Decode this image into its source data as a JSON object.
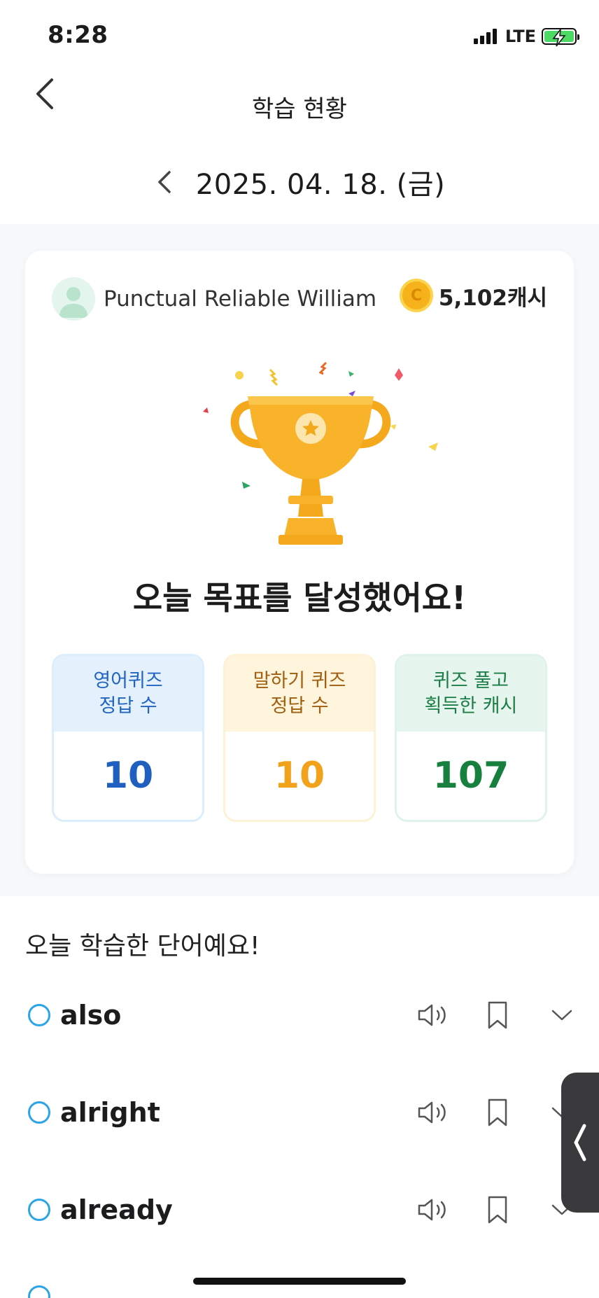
{
  "status_bar": {
    "time": "8:28",
    "network": "LTE"
  },
  "nav": {
    "title": "학습 현황"
  },
  "date": {
    "label": "2025. 04. 18. (금)"
  },
  "profile": {
    "name": "Punctual Reliable William",
    "cash": "5,102캐시",
    "coin_icon": "coin-icon"
  },
  "goal": {
    "message": "오늘 목표를 달성했어요!"
  },
  "stats": [
    {
      "line1": "영어퀴즈",
      "line2": "정답 수",
      "value": "10",
      "color": "#1f5fbf"
    },
    {
      "line1": "말하기 퀴즈",
      "line2": "정답 수",
      "value": "10",
      "color": "#f2a21a"
    },
    {
      "line1": "퀴즈 풀고",
      "line2": "획득한 캐시",
      "value": "107",
      "color": "#17803f"
    }
  ],
  "words_section": {
    "title": "오늘 학습한 단어예요!"
  },
  "words": [
    {
      "word": "also"
    },
    {
      "word": "alright"
    },
    {
      "word": "already"
    }
  ]
}
